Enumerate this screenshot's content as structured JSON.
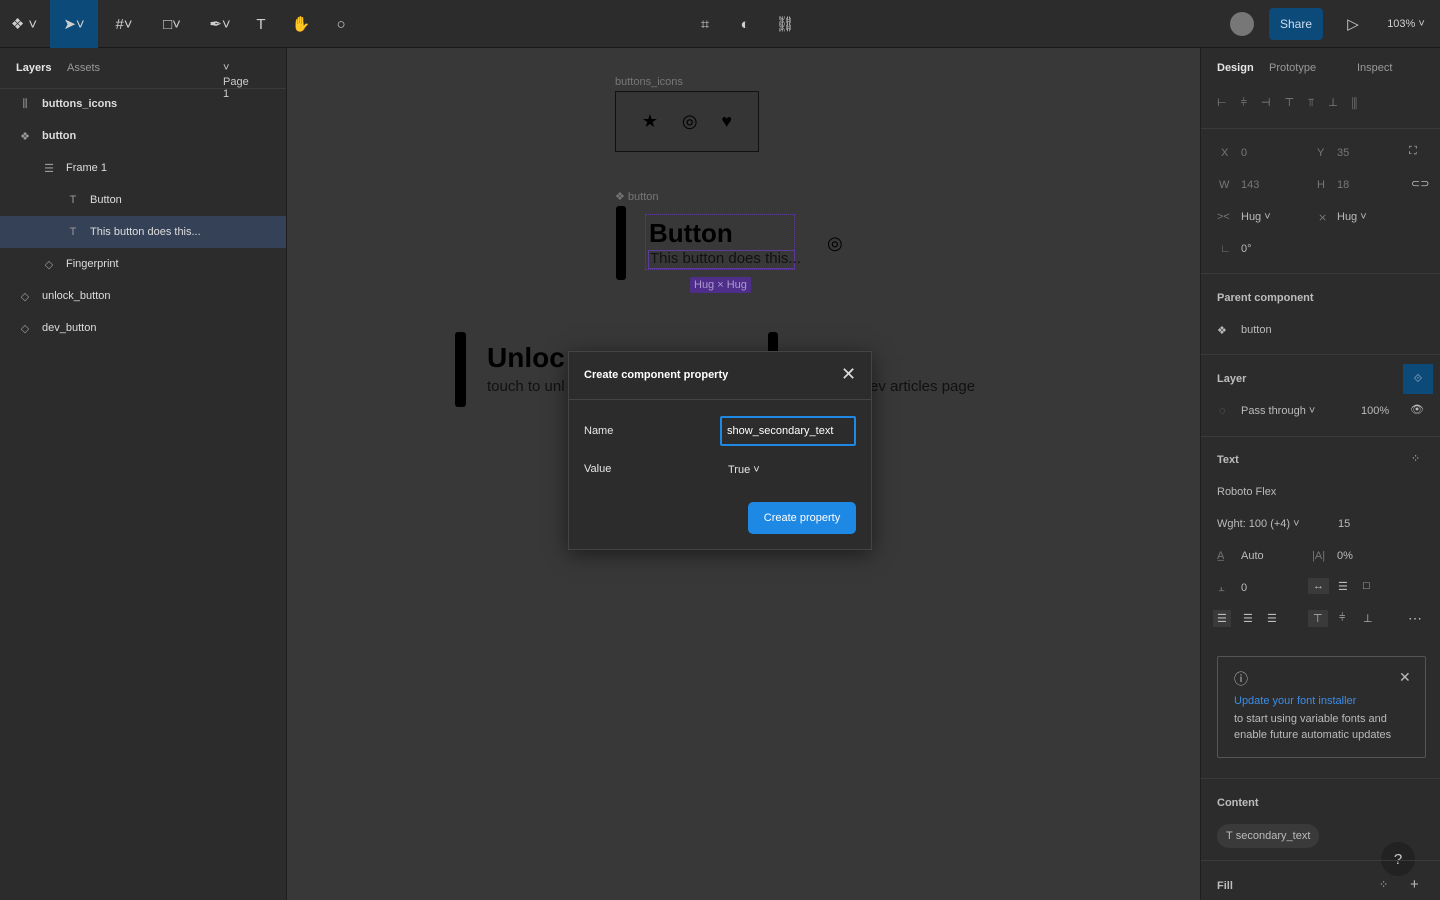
{
  "toolbar": {
    "share_label": "Share",
    "zoom": "103%",
    "accent": "#0c4a7a"
  },
  "left": {
    "tabs": [
      "Layers",
      "Assets"
    ],
    "page": "Page 1",
    "layers": [
      {
        "label": "buttons_icons",
        "icon": "frame-bars-icon",
        "glyph": "⫼",
        "indent": 0,
        "bold": true
      },
      {
        "label": "button",
        "icon": "component-icon",
        "glyph": "❖",
        "indent": 0,
        "bold": true
      },
      {
        "label": "Frame 1",
        "icon": "auto-layout-icon",
        "glyph": "☰",
        "indent": 1
      },
      {
        "label": "Button",
        "icon": "text-icon",
        "glyph": "T",
        "indent": 2
      },
      {
        "label": "This button does this...",
        "icon": "text-icon",
        "glyph": "T",
        "indent": 2,
        "selected": true
      },
      {
        "label": "Fingerprint",
        "icon": "instance-icon",
        "glyph": "◇",
        "indent": 1
      },
      {
        "label": "unlock_button",
        "icon": "instance-icon",
        "glyph": "◇",
        "indent": 0
      },
      {
        "label": "dev_button",
        "icon": "instance-icon",
        "glyph": "◇",
        "indent": 0
      }
    ]
  },
  "canvas": {
    "frame_label": "buttons_icons",
    "component_label": "button",
    "button_title": "Button",
    "button_sub": "This button does this...",
    "hug_badge": "Hug × Hug",
    "unlock_title": "Unloc",
    "unlock_sub": "touch to unl",
    "dev_sub": "ev articles page"
  },
  "dialog": {
    "title": "Create component property",
    "name_label": "Name",
    "name_value": "show_secondary_text",
    "value_label": "Value",
    "value_value": "True",
    "create_label": "Create property"
  },
  "right": {
    "tabs": [
      "Design",
      "Prototype",
      "Inspect"
    ],
    "x_label": "X",
    "x": "0",
    "y_label": "Y",
    "y": "35",
    "w_label": "W",
    "w": "143",
    "h_label": "H",
    "h": "18",
    "hug_w": "Hug",
    "hug_h": "Hug",
    "rotation": "0°",
    "parent_title": "Parent component",
    "parent_name": "button",
    "layer_title": "Layer",
    "blend": "Pass through",
    "opacity": "100%",
    "text_title": "Text",
    "font": "Roboto Flex",
    "weight": "Wght: 100 (+4)",
    "size": "15",
    "line_height": "Auto",
    "letter_spacing": "0%",
    "para_spacing": "0",
    "notice_link": "Update your font installer",
    "notice_text": "to start using variable fonts and enable future automatic updates",
    "content_title": "Content",
    "content_chip": "secondary_text",
    "fill_title": "Fill"
  }
}
